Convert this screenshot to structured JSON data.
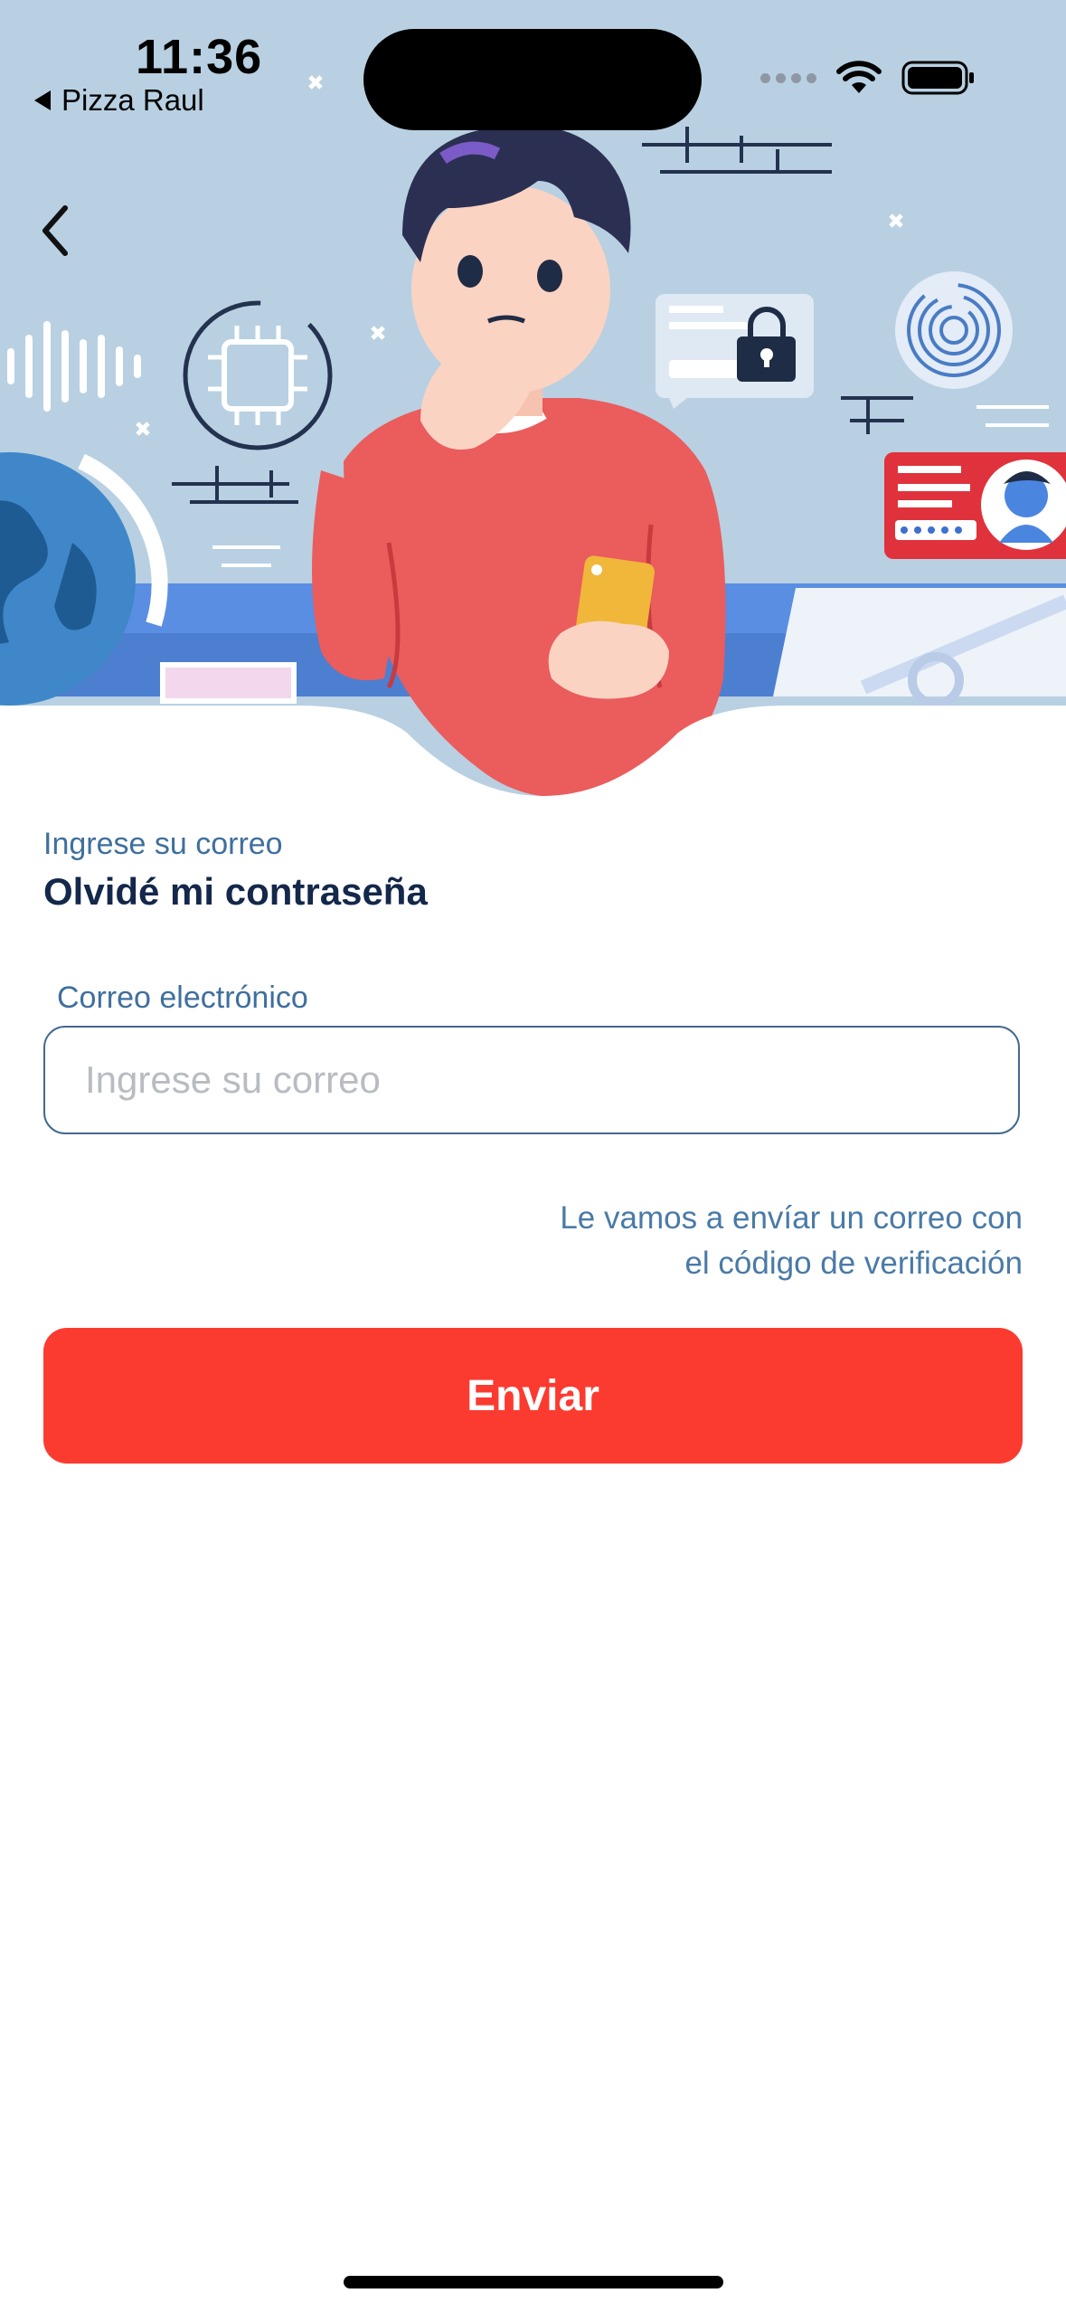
{
  "status_bar": {
    "time": "11:36",
    "back_app_label": "Pizza Raul"
  },
  "hero": {
    "illustration": "person-thinking-with-phone-security-icons"
  },
  "form": {
    "subtitle": "Ingrese su correo",
    "title": "Olvidé mi contraseña",
    "email_label": "Correo electrónico",
    "email_placeholder": "Ingrese su correo",
    "email_value": "",
    "hint_line1": "Le vamos a envíar un correo con",
    "hint_line2": "el código de verificación",
    "submit_label": "Enviar"
  },
  "colors": {
    "primary_button": "#fc3b30",
    "title_text": "#13284a",
    "label_text": "#3f6f9d",
    "hero_background": "#b8d0e2"
  },
  "icons": [
    "back-chevron-icon",
    "wifi-icon",
    "battery-icon",
    "signal-dots-icon"
  ]
}
